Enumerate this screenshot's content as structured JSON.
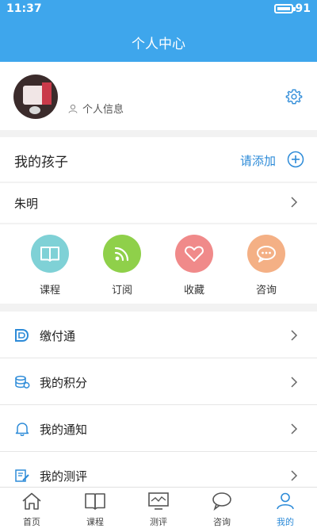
{
  "status": {
    "time": "11:37",
    "battery": "91"
  },
  "header": {
    "title": "个人中心"
  },
  "profile": {
    "info_label": "个人信息"
  },
  "kids": {
    "title": "我的孩子",
    "add_label": "请添加",
    "child_name": "朱明"
  },
  "features": [
    {
      "label": "课程",
      "icon": "book-icon",
      "color": "#7fd1d6"
    },
    {
      "label": "订阅",
      "icon": "rss-icon",
      "color": "#8fd04a"
    },
    {
      "label": "收藏",
      "icon": "heart-icon",
      "color": "#f08a8a"
    },
    {
      "label": "咨询",
      "icon": "chat-icon",
      "color": "#f4b085"
    }
  ],
  "menu": [
    {
      "label": "缴付通",
      "icon": "payment-icon"
    },
    {
      "label": "我的积分",
      "icon": "coins-icon"
    },
    {
      "label": "我的通知",
      "icon": "bell-icon"
    },
    {
      "label": "我的测评",
      "icon": "edit-icon"
    }
  ],
  "tabs": [
    {
      "label": "首页",
      "icon": "home-icon"
    },
    {
      "label": "课程",
      "icon": "book-icon"
    },
    {
      "label": "测评",
      "icon": "monitor-icon"
    },
    {
      "label": "咨询",
      "icon": "chat-icon"
    },
    {
      "label": "我的",
      "icon": "user-icon",
      "active": true
    }
  ],
  "colors": {
    "primary": "#3ea6ec",
    "link": "#2d8bd8",
    "icon_blue": "#2d8bd8"
  }
}
